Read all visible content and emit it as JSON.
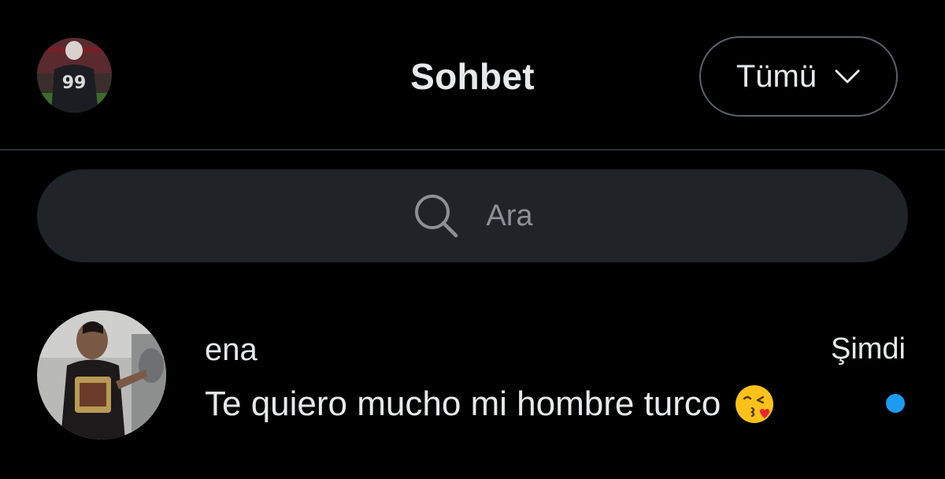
{
  "header": {
    "title": "Sohbet",
    "filter_label": "Tümü",
    "filter_icon": "chevron-down-icon",
    "profile_avatar_icon": "profile-avatar"
  },
  "search": {
    "placeholder": "Ara",
    "icon": "search-icon"
  },
  "conversations": [
    {
      "name": "ena",
      "time": "Şimdi",
      "message": "Te quiero mucho mi hombre turco",
      "emoji": "😘",
      "unread": true
    }
  ],
  "colors": {
    "background": "#000000",
    "text_primary": "#e7e9ea",
    "text_secondary": "#8b9196",
    "search_bg": "#202327",
    "divider": "#2f3336",
    "unread_dot": "#1d9bf0"
  },
  "profile_avatar_text": "99"
}
